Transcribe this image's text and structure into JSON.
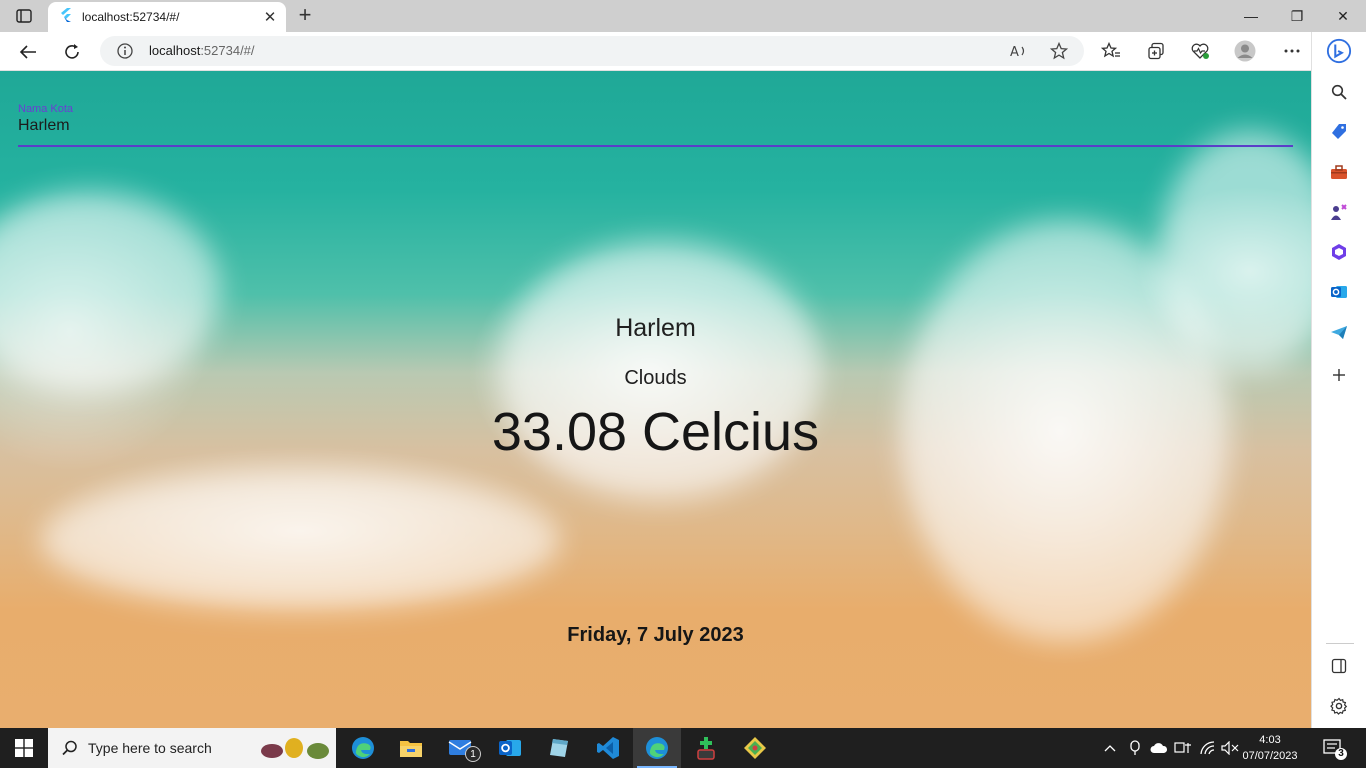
{
  "browser": {
    "tab_title": "localhost:52734/#/",
    "url_host": "localhost",
    "url_rest": ":52734/#/",
    "icons": {
      "tab_actions": "tab-actions-icon",
      "close_tab": "close-icon",
      "new_tab": "plus-icon",
      "back": "back-arrow-icon",
      "refresh": "refresh-icon",
      "site_info": "info-icon",
      "read_aloud": "read-aloud-icon",
      "favorite": "star-icon",
      "favorites": "favorites-icon",
      "collections": "collections-icon",
      "performance": "heartbeat-icon",
      "profile": "avatar-icon",
      "menu": "more-icon",
      "copilot": "bing-icon"
    },
    "window_controls": {
      "minimize": "—",
      "restore": "❐",
      "close": "✕"
    }
  },
  "app": {
    "field_label": "Nama Kota",
    "field_value": "Harlem",
    "city": "Harlem",
    "condition": "Clouds",
    "temperature": "33.08 Celcius",
    "date": "Friday, 7 July 2023",
    "colors": {
      "accent": "#5b3ec8",
      "label": "#6a3fd2"
    }
  },
  "sidebar": {
    "items": [
      "search-icon",
      "shopping-tag-icon",
      "tools-icon",
      "games-icon",
      "office-icon",
      "outlook-icon",
      "telegram-icon",
      "add-icon"
    ],
    "bottom": [
      "split-screen-icon",
      "settings-icon"
    ]
  },
  "taskbar": {
    "search_placeholder": "Type here to search",
    "mail_badge": "1",
    "time": "4:03",
    "date": "07/07/2023",
    "notification_count": "3",
    "apps": [
      "edge-icon",
      "file-explorer-icon",
      "mail-icon",
      "outlook-icon",
      "notepad-icon",
      "vscode-icon",
      "edge-active-icon",
      "green-app-icon",
      "git-icon"
    ]
  }
}
